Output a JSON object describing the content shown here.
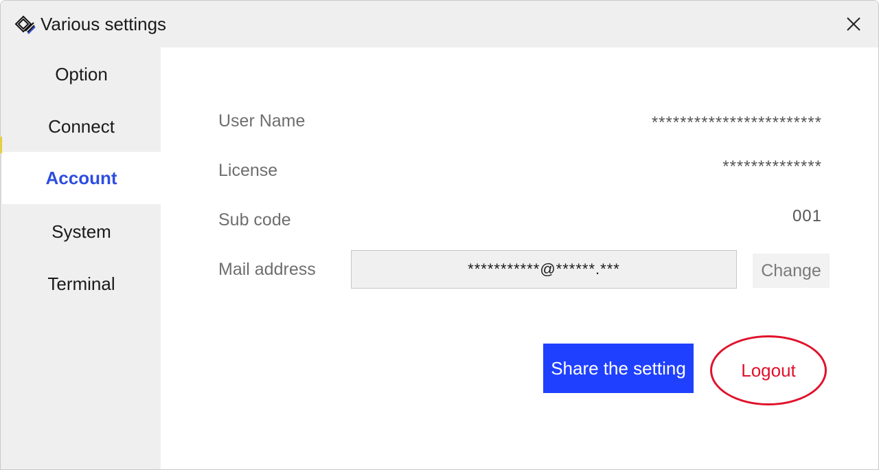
{
  "window": {
    "title": "Various settings",
    "icon": "app-logo-icon",
    "close_icon": "close-icon"
  },
  "sidebar": {
    "items": [
      {
        "label": "Option",
        "active": false
      },
      {
        "label": "Connect",
        "active": false
      },
      {
        "label": "Account",
        "active": true
      },
      {
        "label": "System",
        "active": false
      },
      {
        "label": "Terminal",
        "active": false
      }
    ]
  },
  "account": {
    "user_name_label": "User Name",
    "user_name_value": "************************",
    "license_label": "License",
    "license_value": "**************",
    "sub_code_label": "Sub code",
    "sub_code_value": "001",
    "mail_label": "Mail address",
    "mail_value": "***********@******.***",
    "change_label": "Change",
    "share_label": "Share the setting",
    "logout_label": "Logout"
  },
  "colors": {
    "accent_blue": "#1f40ff",
    "active_nav_text": "#2e4de0",
    "logout_red": "#e0112a",
    "sidebar_bg": "#efefef"
  }
}
